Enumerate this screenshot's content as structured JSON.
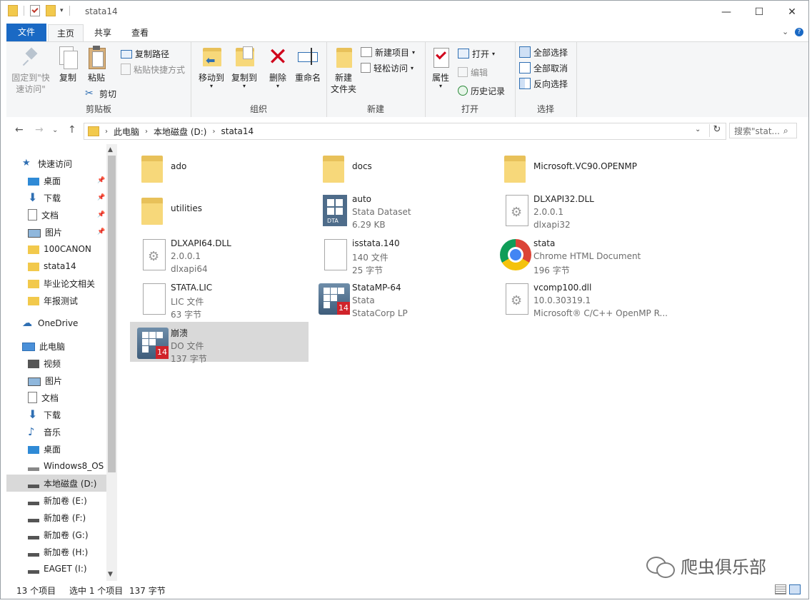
{
  "window": {
    "title": "stata14",
    "controls": {
      "minimize": "—",
      "maximize": "☐",
      "close": "✕"
    }
  },
  "tabs": {
    "file": "文件",
    "home": "主页",
    "share": "共享",
    "view": "查看"
  },
  "ribbon": {
    "clipboard": {
      "pin": "固定到\"快速访问\"",
      "copy": "复制",
      "paste": "粘贴",
      "copy_path": "复制路径",
      "paste_shortcut": "粘贴快捷方式",
      "cut": "剪切",
      "label": "剪贴板"
    },
    "organize": {
      "move_to": "移动到",
      "copy_to": "复制到",
      "delete": "删除",
      "rename": "重命名",
      "label": "组织"
    },
    "new": {
      "new_folder_l1": "新建",
      "new_folder_l2": "文件夹",
      "new_item": "新建项目",
      "easy_access": "轻松访问",
      "label": "新建"
    },
    "open": {
      "properties": "属性",
      "open": "打开",
      "edit": "编辑",
      "history": "历史记录",
      "label": "打开"
    },
    "select": {
      "select_all": "全部选择",
      "select_none": "全部取消",
      "invert": "反向选择",
      "label": "选择"
    }
  },
  "address": {
    "crumbs": [
      "此电脑",
      "本地磁盘 (D:)",
      "stata14"
    ],
    "search_placeholder": "搜索\"stat..."
  },
  "nav": {
    "items": [
      {
        "label": "快速访问"
      },
      {
        "label": "桌面"
      },
      {
        "label": "下载"
      },
      {
        "label": "文档"
      },
      {
        "label": "图片"
      },
      {
        "label": "100CANON"
      },
      {
        "label": "stata14"
      },
      {
        "label": "毕业论文相关"
      },
      {
        "label": "年报测试"
      },
      {
        "label": "OneDrive"
      },
      {
        "label": "此电脑"
      },
      {
        "label": "视频"
      },
      {
        "label": "图片"
      },
      {
        "label": "文档"
      },
      {
        "label": "下载"
      },
      {
        "label": "音乐"
      },
      {
        "label": "桌面"
      },
      {
        "label": "Windows8_OS"
      },
      {
        "label": "本地磁盘 (D:)"
      },
      {
        "label": "新加卷 (E:)"
      },
      {
        "label": "新加卷 (F:)"
      },
      {
        "label": "新加卷 (G:)"
      },
      {
        "label": "新加卷 (H:)"
      },
      {
        "label": "EAGET (I:)"
      }
    ]
  },
  "files": [
    {
      "name": "ado",
      "line2": "",
      "line3": "",
      "icon": "folder-icon"
    },
    {
      "name": "docs",
      "line2": "",
      "line3": "",
      "icon": "folder-icon"
    },
    {
      "name": "Microsoft.VC90.OPENMP",
      "line2": "",
      "line3": "",
      "icon": "folder-icon"
    },
    {
      "name": "utilities",
      "line2": "",
      "line3": "",
      "icon": "folder-icon"
    },
    {
      "name": "auto",
      "line2": "Stata Dataset",
      "line3": "6.29 KB",
      "icon": "dta-file-icon"
    },
    {
      "name": "DLXAPI32.DLL",
      "line2": "2.0.0.1",
      "line3": "dlxapi32",
      "icon": "dll-file-icon"
    },
    {
      "name": "DLXAPI64.DLL",
      "line2": "2.0.0.1",
      "line3": "dlxapi64",
      "icon": "dll-file-icon"
    },
    {
      "name": "isstata.140",
      "line2": "140 文件",
      "line3": "25 字节",
      "icon": "blank-file-icon"
    },
    {
      "name": "stata",
      "line2": "Chrome HTML Document",
      "line3": "196 字节",
      "icon": "chrome-icon"
    },
    {
      "name": "STATA.LIC",
      "line2": "LIC 文件",
      "line3": "63 字节",
      "icon": "blank-file-icon"
    },
    {
      "name": "StataMP-64",
      "line2": "Stata",
      "line3": "StataCorp LP",
      "icon": "stata-app-icon"
    },
    {
      "name": "vcomp100.dll",
      "line2": "10.0.30319.1",
      "line3": "Microsoft® C/C++ OpenMP R...",
      "icon": "dll-file-icon"
    },
    {
      "name": "崩溃",
      "line2": "DO 文件",
      "line3": "137 字节",
      "icon": "stata-do-icon"
    }
  ],
  "status": {
    "count": "13 个项目",
    "selected": "选中 1 个项目",
    "size": "137 字节"
  },
  "watermark": {
    "text": "爬虫俱乐部"
  },
  "colors": {
    "accent": "#1a69c4",
    "selection": "#d9d9d9",
    "folder": "#f7d87a"
  }
}
